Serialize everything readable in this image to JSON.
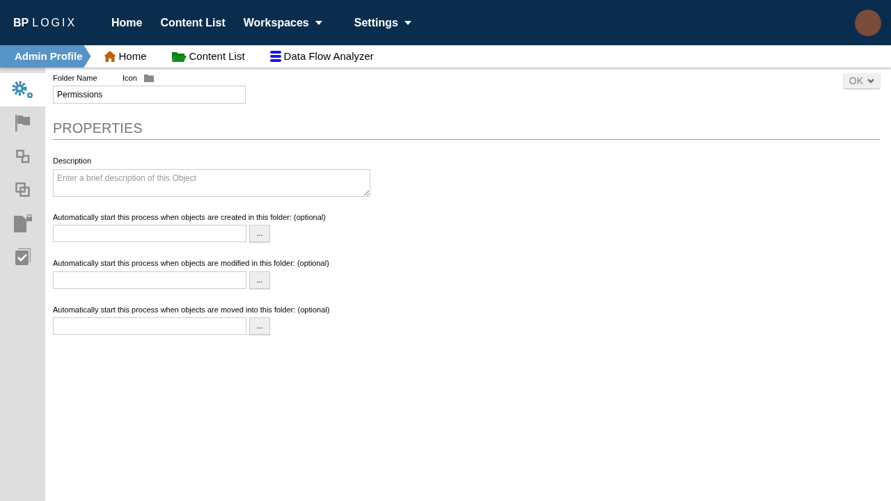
{
  "header": {
    "logo": {
      "prefix": "BP",
      "name": "LOGIX"
    },
    "nav": [
      {
        "label": "Home",
        "dropdown": false
      },
      {
        "label": "Content List",
        "dropdown": false
      },
      {
        "label": "Workspaces",
        "dropdown": true
      },
      {
        "label": "Settings",
        "dropdown": true
      }
    ]
  },
  "breadcrumb": {
    "profile": "Admin Profile",
    "links": [
      {
        "label": "Home",
        "kind": "home"
      },
      {
        "label": "Content List",
        "kind": "folder"
      },
      {
        "label": "Data Flow Analyzer",
        "kind": "database"
      }
    ]
  },
  "sidebar": {
    "tabs": [
      {
        "kind": "gears",
        "selected": true
      },
      {
        "kind": "flag",
        "selected": false
      },
      {
        "kind": "link",
        "selected": false
      },
      {
        "kind": "copy",
        "selected": false
      },
      {
        "kind": "lock",
        "selected": false
      },
      {
        "kind": "check",
        "selected": false
      }
    ]
  },
  "ok_button": "OK",
  "form": {
    "folder_name_label": "Folder Name",
    "icon_label": "Icon",
    "folder_name": "Permissions",
    "section_title": "PROPERTIES",
    "description_label": "Description",
    "description_placeholder": "Enter a brief description of this Object",
    "triggers": [
      {
        "label": "Automatically start this process when objects are created in this folder: (optional)",
        "button": "..."
      },
      {
        "label": "Automatically start this process when objects are modified in this folder: (optional)",
        "button": "..."
      },
      {
        "label": "Automatically start this process when objects are moved into this folder: (optional)",
        "button": "..."
      }
    ]
  }
}
